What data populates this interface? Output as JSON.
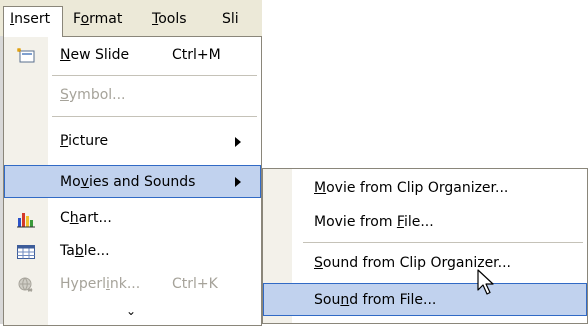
{
  "menubar": {
    "insert": {
      "pre": "",
      "key": "I",
      "post": "nsert"
    },
    "format": {
      "pre": "F",
      "key": "o",
      "post": "rmat"
    },
    "tools": {
      "pre": "",
      "key": "T",
      "post": "ools"
    },
    "slide": {
      "pre": "Sli",
      "key": "",
      "post": ""
    }
  },
  "insert_menu": {
    "new_slide": {
      "pre": "",
      "key": "N",
      "post": "ew Slide",
      "shortcut": "Ctrl+M",
      "icon": "new-slide-icon"
    },
    "symbol": {
      "pre": "",
      "key": "S",
      "post": "ymbol...",
      "disabled": true
    },
    "picture": {
      "pre": "",
      "key": "P",
      "post": "icture"
    },
    "movies_sounds": {
      "pre": "Mo",
      "key": "v",
      "post": "ies and Sounds"
    },
    "chart": {
      "pre": "C",
      "key": "h",
      "post": "art...",
      "icon": "chart-icon"
    },
    "table": {
      "pre": "Ta",
      "key": "b",
      "post": "le...",
      "icon": "table-icon"
    },
    "hyperlink": {
      "pre": "Hyperl",
      "key": "i",
      "post": "nk...",
      "shortcut": "Ctrl+K",
      "disabled": true,
      "icon": "hyperlink-icon"
    },
    "expand": "⌄"
  },
  "submenu": {
    "movie_clip": {
      "pre": "",
      "key": "M",
      "post": "ovie from Clip Organizer..."
    },
    "movie_file": {
      "pre": "Movie from ",
      "key": "F",
      "post": "ile..."
    },
    "sound_clip": {
      "pre": "",
      "key": "S",
      "post": "ound from Clip Organizer..."
    },
    "sound_file": {
      "pre": "Sou",
      "key": "n",
      "post": "d from File..."
    }
  },
  "colors": {
    "highlight": "#c1d2ee",
    "highlight_border": "#316ac5",
    "menubar": "#ece9d8",
    "disabled": "#a6a39a"
  }
}
